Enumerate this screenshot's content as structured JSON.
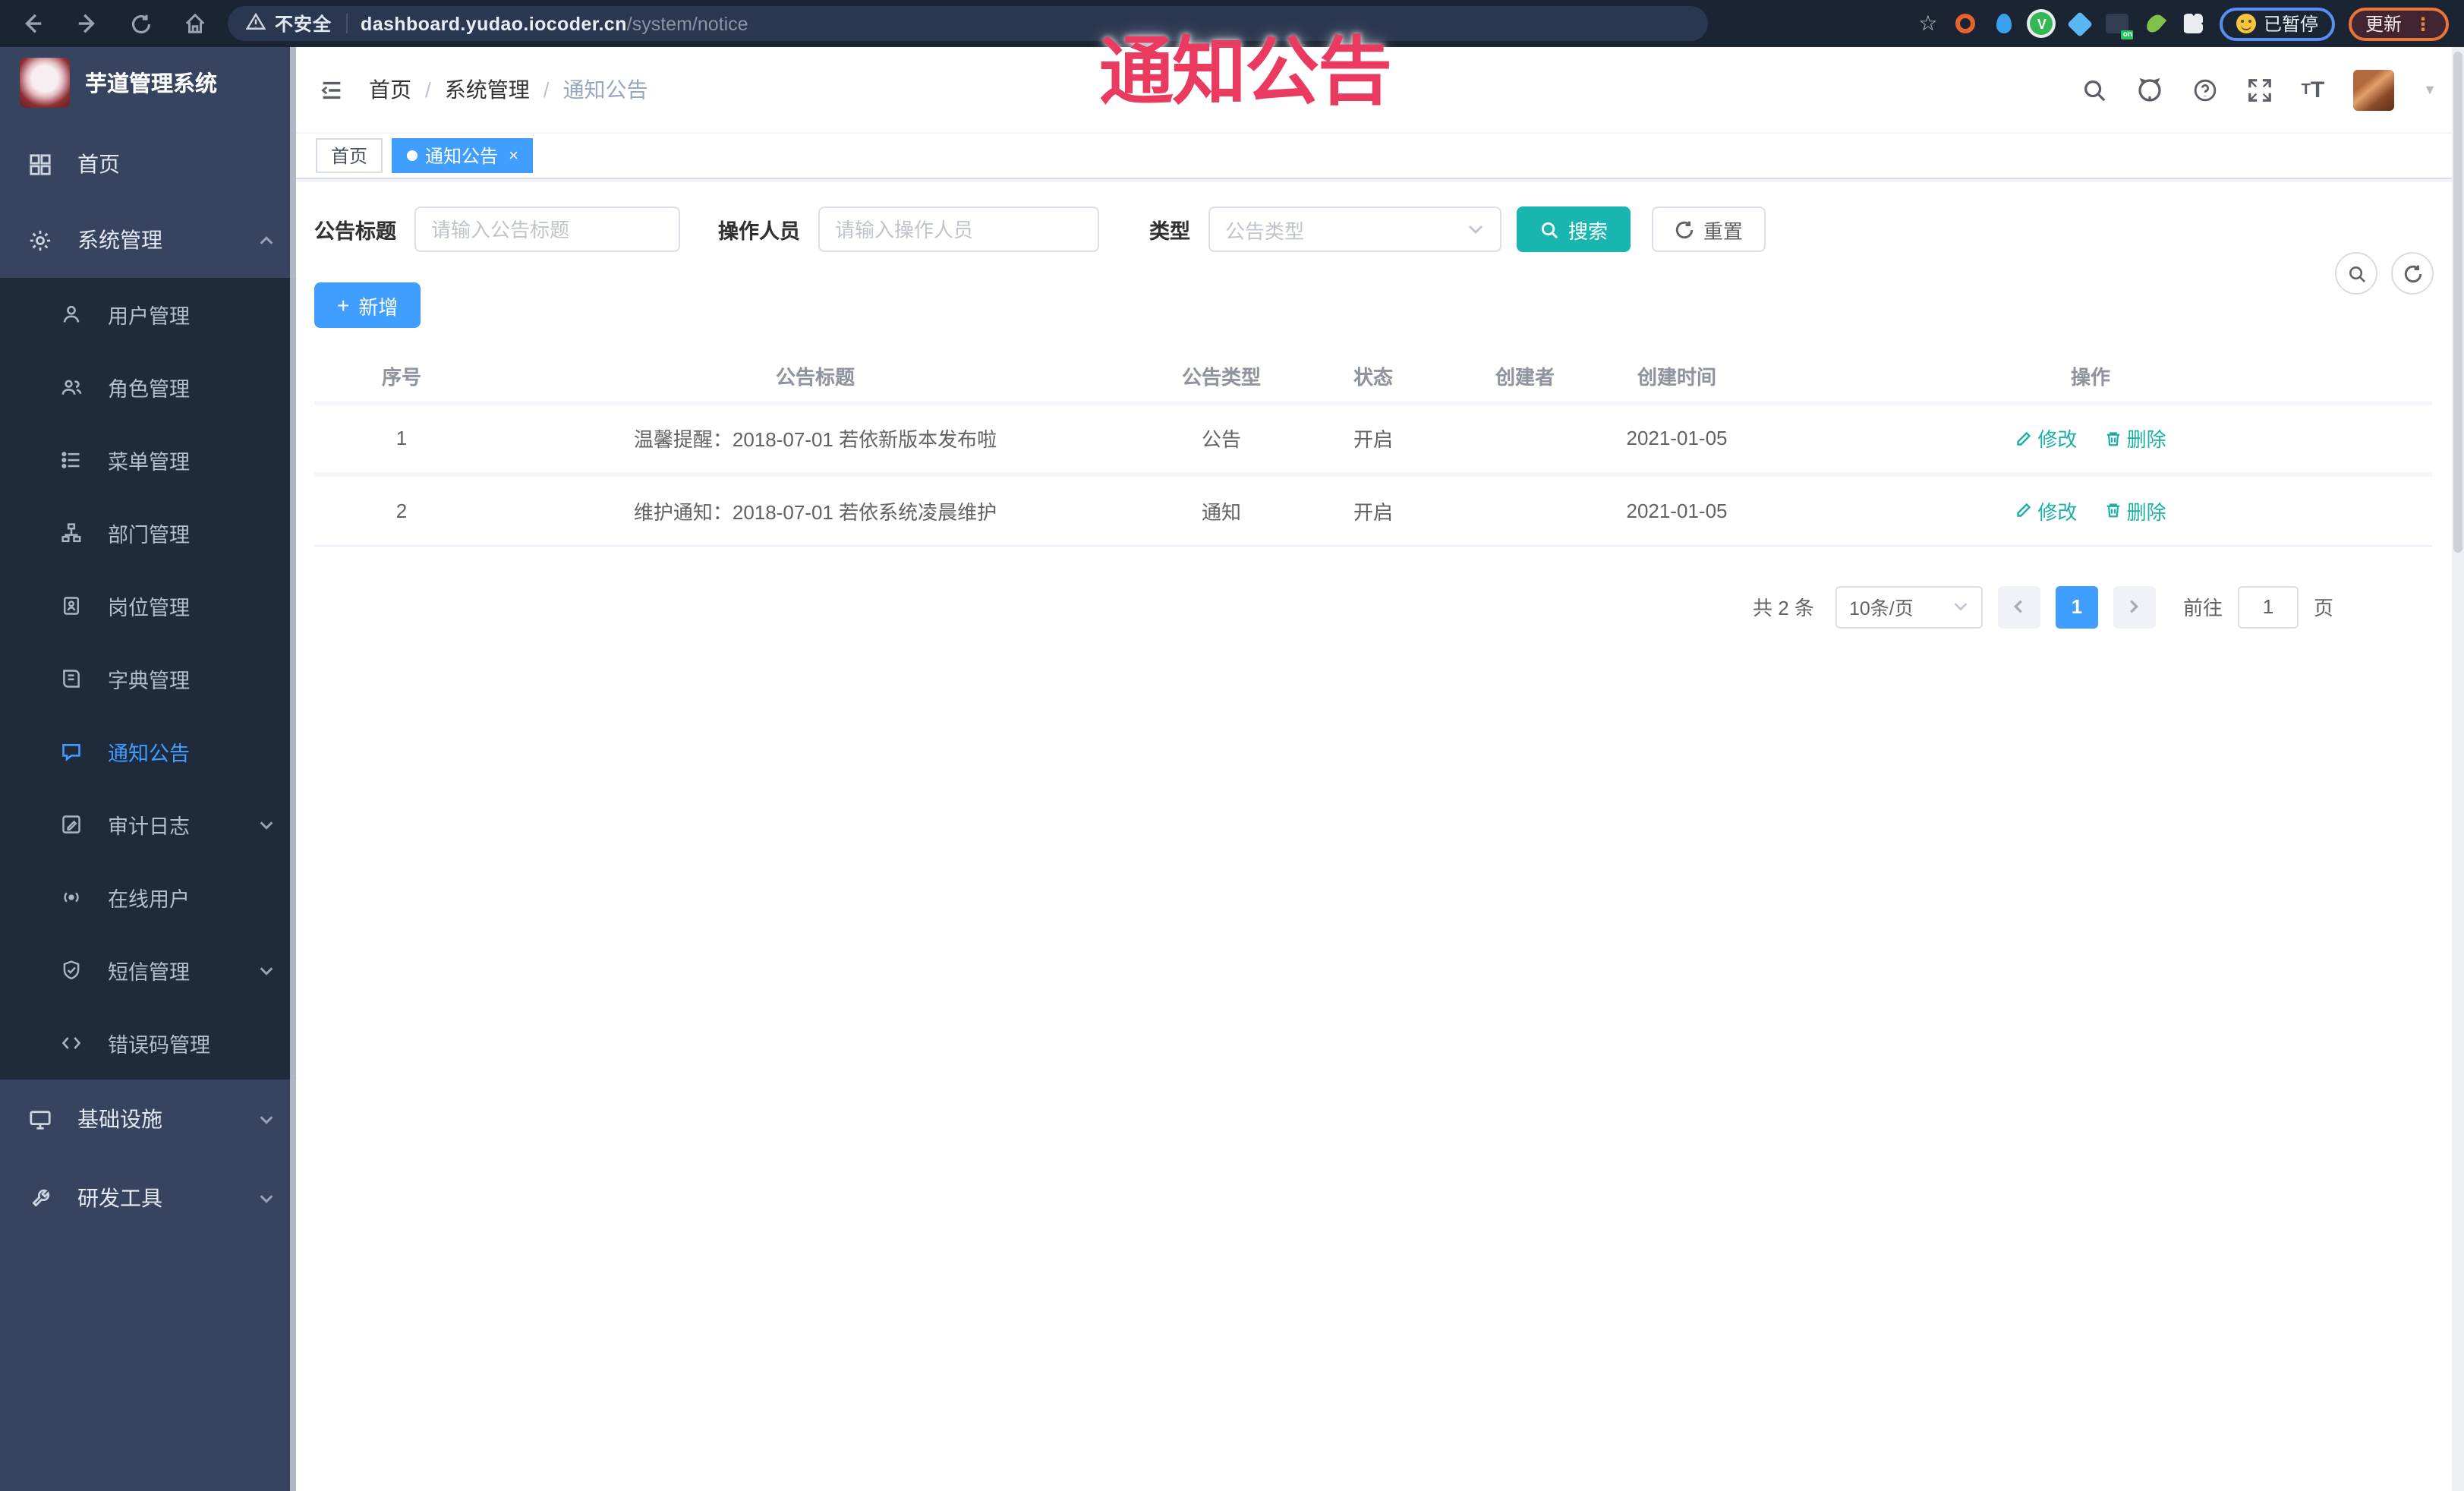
{
  "browser": {
    "security_label": "不安全",
    "url_host": "dashboard.yudao.iocoder.cn",
    "url_path": "/system/notice",
    "extensions": {
      "paused_label": "已暂停",
      "update_label": "更新",
      "on_badge": "on",
      "menu_dots": "⋮",
      "green_letter": "V"
    }
  },
  "overlay": {
    "title": "通知公告"
  },
  "sidebar": {
    "title": "芋道管理系统",
    "items": [
      {
        "label": "首页"
      },
      {
        "label": "系统管理"
      },
      {
        "label": "用户管理"
      },
      {
        "label": "角色管理"
      },
      {
        "label": "菜单管理"
      },
      {
        "label": "部门管理"
      },
      {
        "label": "岗位管理"
      },
      {
        "label": "字典管理"
      },
      {
        "label": "通知公告"
      },
      {
        "label": "审计日志"
      },
      {
        "label": "在线用户"
      },
      {
        "label": "短信管理"
      },
      {
        "label": "错误码管理"
      },
      {
        "label": "基础设施"
      },
      {
        "label": "研发工具"
      }
    ]
  },
  "header": {
    "breadcrumb": [
      "首页",
      "系统管理",
      "通知公告"
    ]
  },
  "tabs": [
    {
      "label": "首页"
    },
    {
      "label": "通知公告"
    }
  ],
  "filters": {
    "title_label": "公告标题",
    "title_placeholder": "请输入公告标题",
    "operator_label": "操作人员",
    "operator_placeholder": "请输入操作人员",
    "type_label": "类型",
    "type_placeholder": "公告类型",
    "search_label": "搜索",
    "reset_label": "重置"
  },
  "toolbar": {
    "add_label": "新增"
  },
  "table": {
    "columns": [
      "序号",
      "公告标题",
      "公告类型",
      "状态",
      "创建者",
      "创建时间",
      "操作"
    ],
    "rows": [
      {
        "index": "1",
        "title": "温馨提醒：2018-07-01 若依新版本发布啦",
        "type": "公告",
        "status": "开启",
        "creator": "",
        "create_time": "2021-01-05",
        "edit": "修改",
        "delete": "删除"
      },
      {
        "index": "2",
        "title": "维护通知：2018-07-01 若依系统凌晨维护",
        "type": "通知",
        "status": "开启",
        "creator": "",
        "create_time": "2021-01-05",
        "edit": "修改",
        "delete": "删除"
      }
    ]
  },
  "pagination": {
    "total": "共 2 条",
    "page_size": "10条/页",
    "current_page": "1",
    "goto_label": "前往",
    "goto_value": "1",
    "page_unit": "页"
  },
  "colors": {
    "accent_blue": "#409eff",
    "teal": "#18b5b1",
    "sidebar_bg": "#37445f",
    "submenu_bg": "#1f2b3a",
    "toolbar_bg": "#1b2433",
    "overlay_red": "#ea3a60",
    "active_tab": "#409eff"
  }
}
